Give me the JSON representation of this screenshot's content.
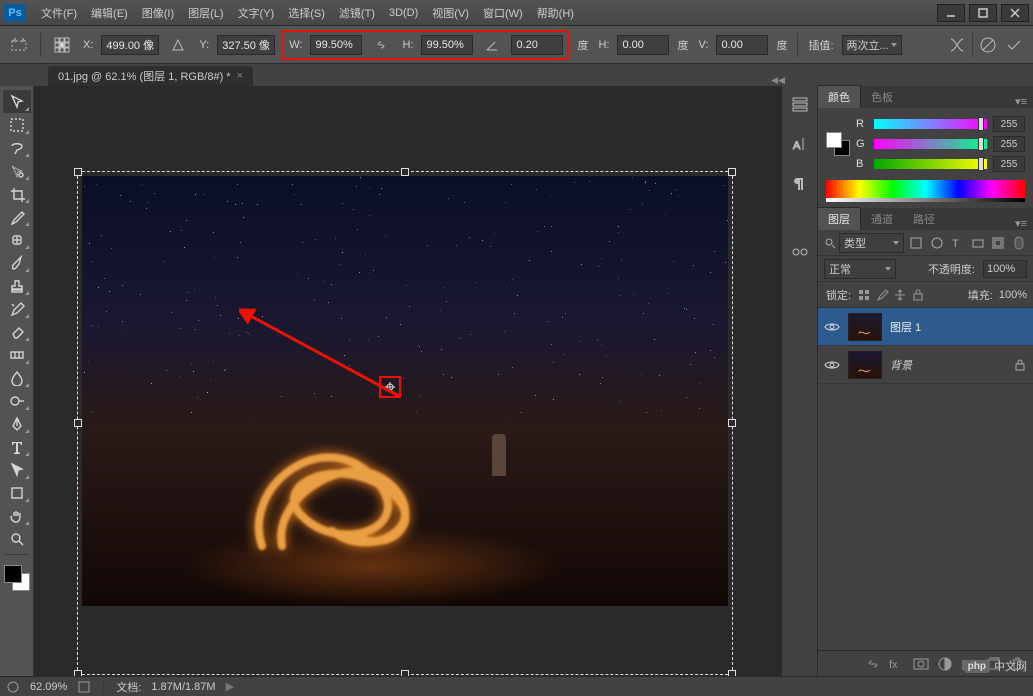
{
  "app": {
    "logo": "Ps"
  },
  "menu": [
    "文件(F)",
    "编辑(E)",
    "图像(I)",
    "图层(L)",
    "文字(Y)",
    "选择(S)",
    "滤镜(T)",
    "3D(D)",
    "视图(V)",
    "窗口(W)",
    "帮助(H)"
  ],
  "options": {
    "x_label": "X:",
    "x": "499.00 像",
    "y_label": "Y:",
    "y": "327.50 像",
    "w_label": "W:",
    "w": "99.50%",
    "h_label": "H:",
    "h": "99.50%",
    "rot": "0.20",
    "rot_unit": "度",
    "hskew_label": "H:",
    "hskew": "0.00",
    "hskew_unit": "度",
    "vskew_label": "V:",
    "vskew": "0.00",
    "vskew_unit": "度",
    "interp_label": "插值:",
    "interp": "两次立..."
  },
  "doc": {
    "tab": "01.jpg @ 62.1% (图层 1, RGB/8#) *"
  },
  "color_panel": {
    "tab_active": "颜色",
    "tab_inactive": "色板",
    "r_label": "R",
    "r": "255",
    "g_label": "G",
    "g": "255",
    "b_label": "B",
    "b": "255"
  },
  "layers_panel": {
    "tabs": [
      "图层",
      "通道",
      "路径"
    ],
    "kind_label": "类型",
    "blend": "正常",
    "opacity_label": "不透明度:",
    "opacity": "100%",
    "lock_label": "锁定:",
    "fill_label": "填充:",
    "fill": "100%",
    "layers": [
      {
        "name": "图层 1",
        "sel": true,
        "locked": false
      },
      {
        "name": "背景",
        "sel": false,
        "locked": true
      }
    ]
  },
  "status": {
    "zoom": "62.09%",
    "docinfo_label": "文档:",
    "docinfo": "1.87M/1.87M"
  },
  "watermark": {
    "badge": "php",
    "text": "中文网"
  }
}
